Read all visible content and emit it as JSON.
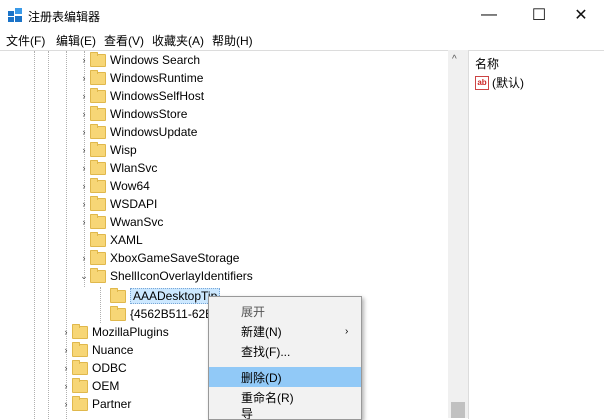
{
  "window": {
    "title": "注册表编辑器",
    "minimize_glyph": "—",
    "maximize_glyph": "☐",
    "close_glyph": "✕"
  },
  "menu": [
    "文件(F)",
    "编辑(E)",
    "查看(V)",
    "收藏夹(A)",
    "帮助(H)"
  ],
  "tree": [
    {
      "label": "Windows Search",
      "expander": "›",
      "depth": 1
    },
    {
      "label": "WindowsRuntime",
      "expander": "›",
      "depth": 1
    },
    {
      "label": "WindowsSelfHost",
      "expander": "›",
      "depth": 1
    },
    {
      "label": "WindowsStore",
      "expander": "›",
      "depth": 1
    },
    {
      "label": "WindowsUpdate",
      "expander": "›",
      "depth": 1
    },
    {
      "label": "Wisp",
      "expander": "›",
      "depth": 1
    },
    {
      "label": "WlanSvc",
      "expander": "›",
      "depth": 1
    },
    {
      "label": "Wow64",
      "expander": "›",
      "depth": 1
    },
    {
      "label": "WSDAPI",
      "expander": "›",
      "depth": 1
    },
    {
      "label": "WwanSvc",
      "expander": "›",
      "depth": 1
    },
    {
      "label": "XAML",
      "expander": "",
      "depth": 1
    },
    {
      "label": "XboxGameSaveStorage",
      "expander": "›",
      "depth": 1
    },
    {
      "label": "ShellIconOverlayIdentifiers",
      "expander": "⌄",
      "depth": 1
    },
    {
      "label": "AAADesktopTip",
      "expander": "",
      "depth": 2,
      "selected": true
    },
    {
      "label": "{4562B511-62E",
      "expander": "",
      "depth": 2
    },
    {
      "label": "MozillaPlugins",
      "expander": "›",
      "depth": 0
    },
    {
      "label": "Nuance",
      "expander": "›",
      "depth": 0
    },
    {
      "label": "ODBC",
      "expander": "›",
      "depth": 0
    },
    {
      "label": "OEM",
      "expander": "›",
      "depth": 0
    },
    {
      "label": "Partner",
      "expander": "›",
      "depth": 0
    }
  ],
  "right_pane": {
    "header": "名称",
    "value_icon": "ab",
    "value_name": "(默认)"
  },
  "context_menu": {
    "items": [
      {
        "label": "展开",
        "dim": true
      },
      {
        "label": "新建(N)",
        "submenu": "›"
      },
      {
        "label": "查找(F)..."
      },
      {
        "label": "删除(D)",
        "highlight": true
      },
      {
        "label": "重命名(R)"
      },
      {
        "label": "导"
      }
    ]
  },
  "scroll_up_glyph": "^"
}
